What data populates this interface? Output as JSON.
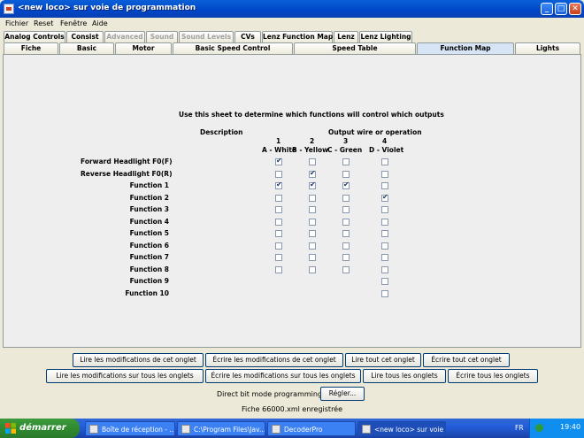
{
  "window": {
    "title": "<new loco> sur voie de programmation"
  },
  "menu": [
    "Fichier",
    "Reset",
    "Fenêtre",
    "Aide"
  ],
  "tabs_row1": [
    "Analog Controls",
    "Consist",
    "Advanced",
    "Sound",
    "Sound Levels",
    "CVs",
    "Lenz Function Map",
    "Lenz",
    "Lenz Lighting"
  ],
  "tabs_row2": [
    "Fiche",
    "Basic",
    "Motor",
    "Basic Speed Control",
    "Speed Table",
    "Function Map",
    "Lights"
  ],
  "panel": {
    "instructions": "Use this sheet to determine which functions will control which outputs",
    "description_header": "Description",
    "output_header": "Output wire or operation",
    "columns": [
      {
        "number": "1",
        "label": "A - White"
      },
      {
        "number": "2",
        "label": "B - Yellow"
      },
      {
        "number": "3",
        "label": "C - Green"
      },
      {
        "number": "4",
        "label": "D - Violet"
      }
    ],
    "rows": [
      {
        "label": "Forward Headlight F0(F)",
        "checks": [
          true,
          false,
          false,
          false
        ]
      },
      {
        "label": "Reverse Headlight F0(R)",
        "checks": [
          false,
          true,
          false,
          false
        ]
      },
      {
        "label": "Function 1",
        "checks": [
          true,
          true,
          true,
          false
        ]
      },
      {
        "label": "Function 2",
        "checks": [
          false,
          false,
          false,
          true
        ]
      },
      {
        "label": "Function 3",
        "checks": [
          false,
          false,
          false,
          false
        ]
      },
      {
        "label": "Function 4",
        "checks": [
          false,
          false,
          false,
          false
        ]
      },
      {
        "label": "Function 5",
        "checks": [
          false,
          false,
          false,
          false
        ]
      },
      {
        "label": "Function 6",
        "checks": [
          false,
          false,
          false,
          false
        ]
      },
      {
        "label": "Function 7",
        "checks": [
          false,
          false,
          false,
          false
        ]
      },
      {
        "label": "Function 8",
        "checks": [
          false,
          false,
          false,
          false
        ]
      },
      {
        "label": "Function 9",
        "checks": [
          null,
          null,
          null,
          false
        ]
      },
      {
        "label": "Function 10",
        "checks": [
          null,
          null,
          null,
          false
        ]
      }
    ]
  },
  "buttons": {
    "read_changes_tab": "Lire les modifications de cet onglet",
    "write_changes_tab": "Écrire les modifications de cet onglet",
    "read_all_tab": "Lire tout cet onglet",
    "write_all_tab": "Écrire tout cet onglet",
    "read_changes_all": "Lire les modifications sur tous les onglets",
    "write_changes_all": "Écrire les modifications sur tous les onglets",
    "read_all": "Lire tous les onglets",
    "write_all": "Écrire tous les onglets",
    "mode_label": "Direct bit mode programming",
    "set": "Régler..."
  },
  "status": "Fiche 66000.xml enregistrée",
  "taskbar": {
    "start": "démarrer",
    "tasks": [
      "Boîte de réception - ...",
      "C:\\Program Files\\Jav...",
      "DecoderPro",
      "<new loco> sur voie ..."
    ],
    "lang": "FR",
    "clock": "19:40"
  }
}
